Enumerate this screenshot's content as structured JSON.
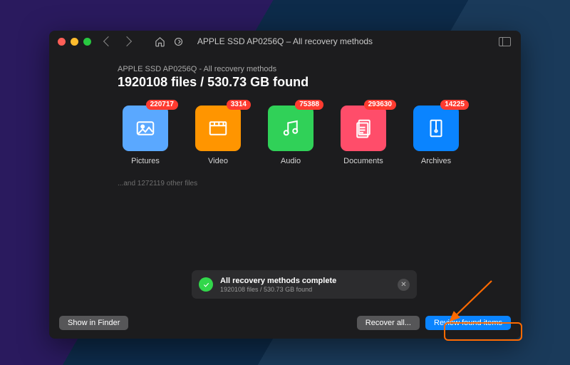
{
  "window": {
    "title": "APPLE SSD AP0256Q – All recovery methods"
  },
  "header": {
    "subtitle": "APPLE SSD AP0256Q - All recovery methods",
    "headline": "1920108 files / 530.73 GB found"
  },
  "categories": [
    {
      "label": "Pictures",
      "badge": "220717",
      "color": "#5aa8ff",
      "icon": "image"
    },
    {
      "label": "Video",
      "badge": "3314",
      "color": "#ff9500",
      "icon": "video"
    },
    {
      "label": "Audio",
      "badge": "75388",
      "color": "#30d158",
      "icon": "audio"
    },
    {
      "label": "Documents",
      "badge": "293630",
      "color": "#ff4d6a",
      "icon": "doc"
    },
    {
      "label": "Archives",
      "badge": "14225",
      "color": "#0a84ff",
      "icon": "archive"
    }
  ],
  "other_files_note": "...and 1272119 other files",
  "status": {
    "title": "All recovery methods complete",
    "detail": "1920108 files / 530.73 GB found"
  },
  "footer": {
    "show_in_finder": "Show in Finder",
    "recover_all": "Recover all...",
    "review": "Review found items"
  }
}
